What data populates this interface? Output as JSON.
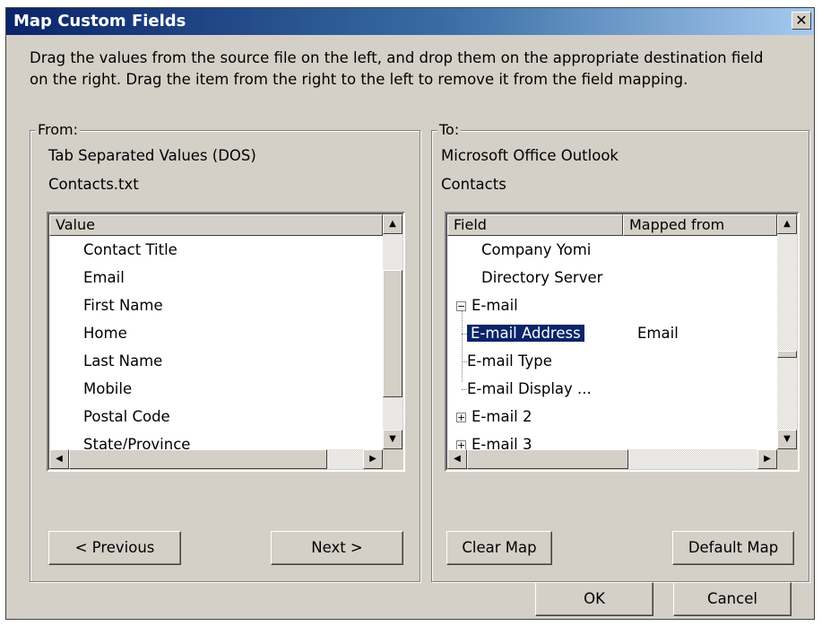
{
  "dialog": {
    "title": "Map Custom Fields",
    "close_glyph": "✕",
    "instructions_line1": "Drag the values from the source file on the left, and drop them on the appropriate destination field",
    "instructions_line2": "on the right.  Drag the item from the right to the left to remove it from the field mapping."
  },
  "from": {
    "legend": "From:",
    "source_type": "Tab Separated Values (DOS)",
    "source_file": "Contacts.txt",
    "column_header": "Value",
    "items": [
      "Contact Title",
      "Email",
      "First Name",
      "Home",
      "Last Name",
      "Mobile",
      "Postal Code",
      "State/Province"
    ],
    "previous_button": "< Previous",
    "next_button": "Next >"
  },
  "to": {
    "legend": "To:",
    "dest_app": "Microsoft Office Outlook",
    "dest_folder": "Contacts",
    "column_field": "Field",
    "column_mapped": "Mapped from",
    "rows": [
      {
        "field": "Company Yomi",
        "mapped": ""
      },
      {
        "field": "Directory Server",
        "mapped": ""
      },
      {
        "field": "E-mail",
        "mapped": "",
        "expander": "−"
      },
      {
        "field": "E-mail Address",
        "mapped": "Email"
      },
      {
        "field": "E-mail Type",
        "mapped": ""
      },
      {
        "field": "E-mail Display ...",
        "mapped": ""
      },
      {
        "field": "E-mail 2",
        "mapped": "",
        "expander": "+"
      },
      {
        "field": "E-mail 3",
        "mapped": "",
        "expander": "+"
      }
    ],
    "clear_map_button": "Clear Map",
    "default_map_button": "Default Map"
  },
  "footer": {
    "ok_button": "OK",
    "cancel_button": "Cancel"
  },
  "colors": {
    "selection": "#0a246a",
    "face": "#d4d0c8"
  }
}
